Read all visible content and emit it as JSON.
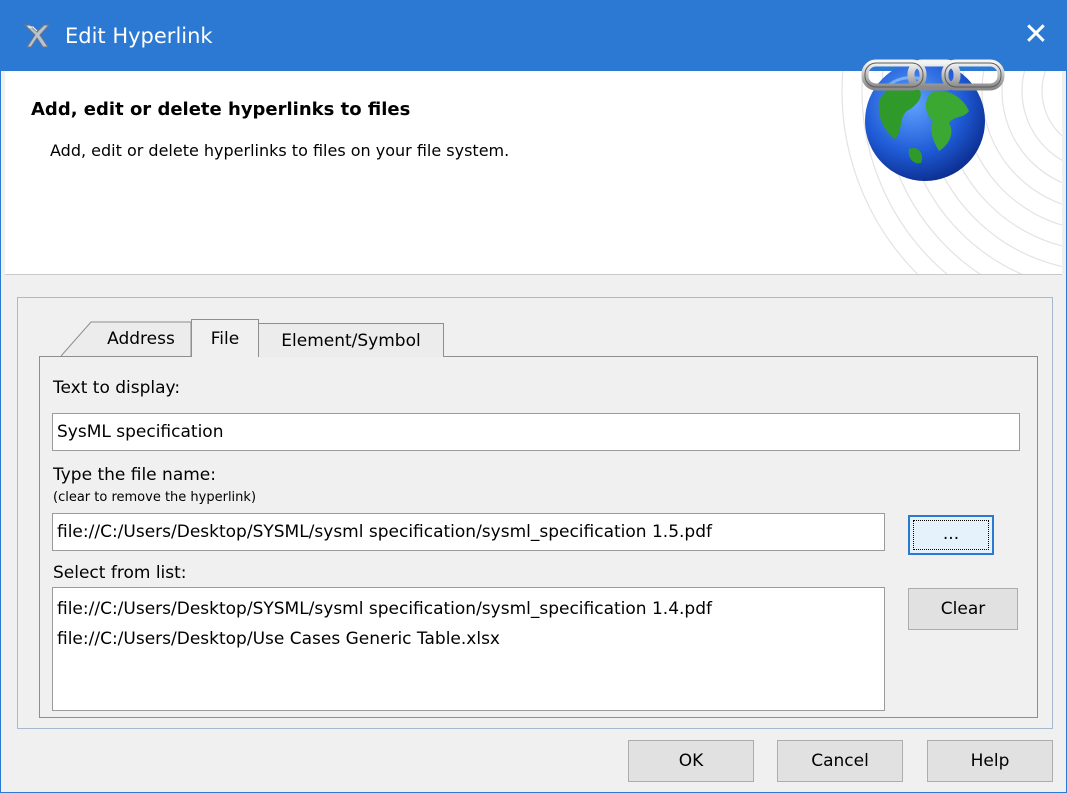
{
  "window": {
    "title": "Edit Hyperlink",
    "close_symbol": "✕"
  },
  "header": {
    "title": "Add, edit or delete hyperlinks to files",
    "description": "Add, edit or delete hyperlinks to files on your file system.",
    "image": "globe-chain-icon"
  },
  "tabs": [
    {
      "label": "Address",
      "active": false
    },
    {
      "label": "File",
      "active": true
    },
    {
      "label": "Element/Symbol",
      "active": false
    }
  ],
  "form": {
    "display_label": "Text to display:",
    "display_value": "SysML specification",
    "filename_label": "Type the file name:",
    "filename_hint": "(clear to remove the hyperlink)",
    "filename_value": "file://C:/Users/Desktop/SYSML/sysml specification/sysml_specification 1.5.pdf",
    "browse_label": "...",
    "list_label": "Select from list:",
    "list_items": [
      "file://C:/Users/Desktop/SYSML/sysml specification/sysml_specification 1.4.pdf",
      "file://C:/Users/Desktop/Use Cases Generic Table.xlsx"
    ],
    "clear_label": "Clear"
  },
  "footer": {
    "ok_label": "OK",
    "cancel_label": "Cancel",
    "help_label": "Help"
  },
  "colors": {
    "titlebar": "#2b79d2",
    "background": "#f0f0f0",
    "button": "#e1e1e1",
    "focus": "#2b79d2"
  }
}
